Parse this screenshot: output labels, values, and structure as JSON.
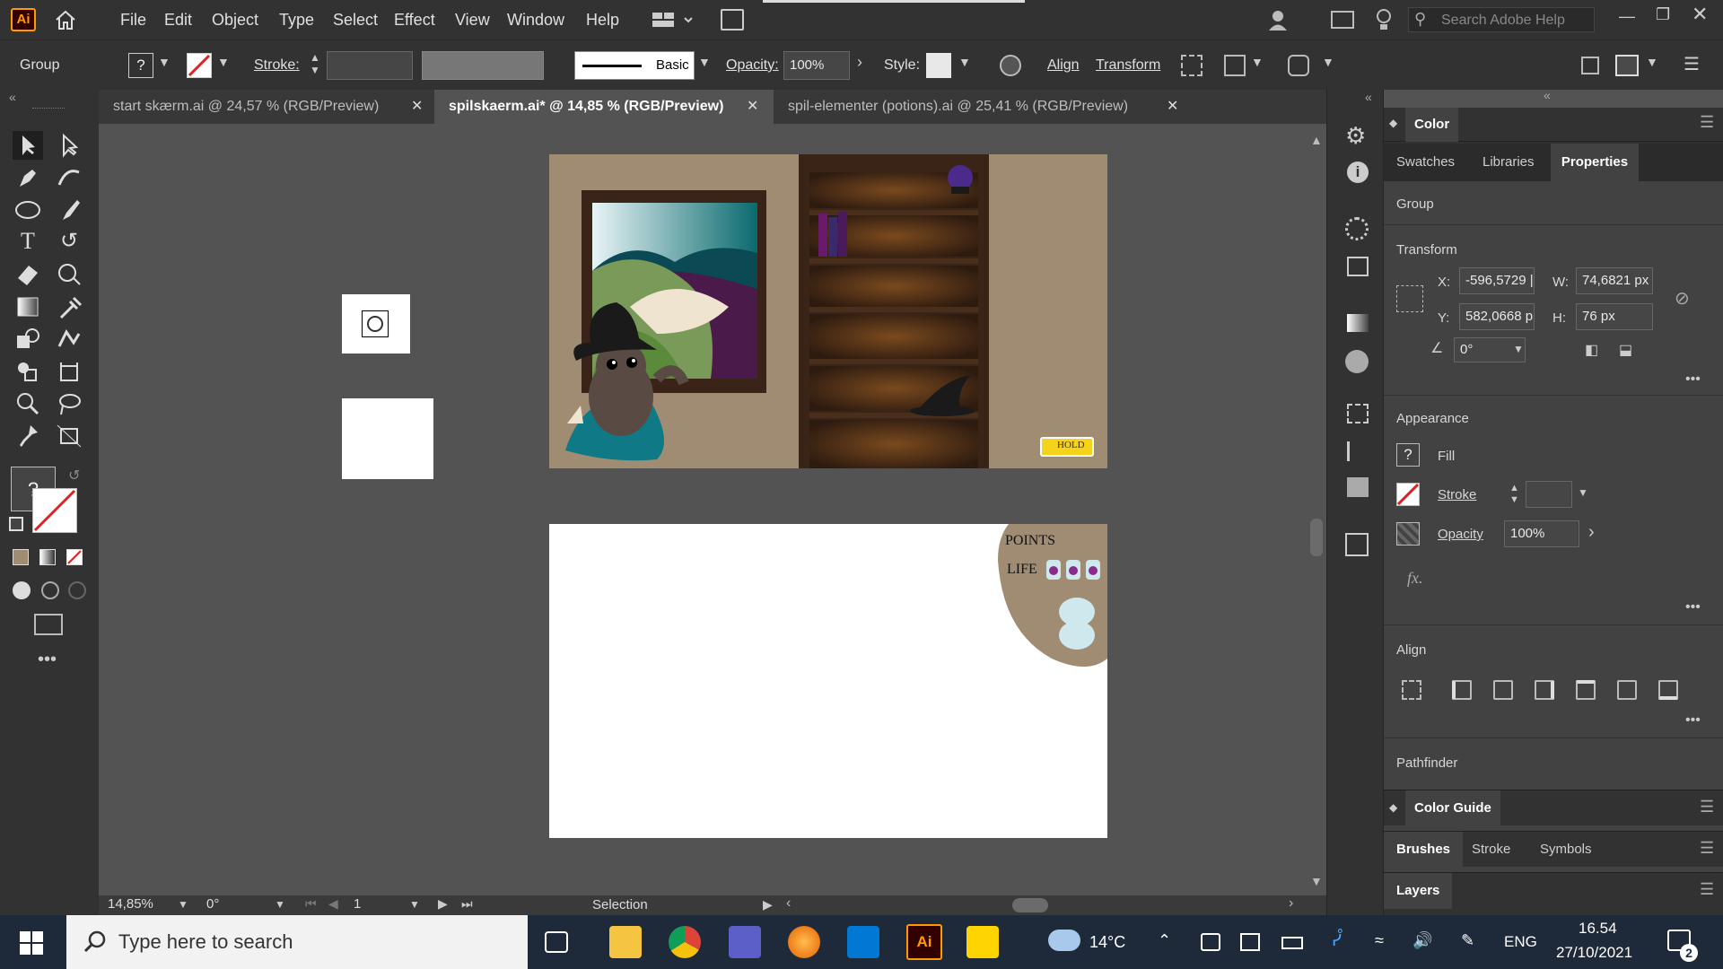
{
  "app": {
    "logo": "Ai",
    "colors": {
      "accent": "#ff9a00",
      "bg": "#535353",
      "panel": "#323232"
    }
  },
  "menubar": {
    "items": [
      "File",
      "Edit",
      "Object",
      "Type",
      "Select",
      "Effect",
      "View",
      "Window",
      "Help"
    ],
    "search_placeholder": "Search Adobe Help"
  },
  "control_bar": {
    "selection_type": "Group",
    "fill_unknown": "?",
    "stroke_label": "Stroke:",
    "brush_label": "Basic",
    "opacity_label": "Opacity:",
    "opacity_value": "100%",
    "style_label": "Style:",
    "align_label": "Align",
    "transform_label": "Transform"
  },
  "tabs": [
    {
      "label": "start skærm.ai @ 24,57 % (RGB/Preview)",
      "active": false
    },
    {
      "label": "spilskaerm.ai* @ 14,85 % (RGB/Preview)",
      "active": true
    },
    {
      "label": "spil-elementer (potions).ai @ 25,41 % (RGB/Preview)",
      "active": false
    }
  ],
  "canvas": {
    "artboard1": {
      "hold_label": "HOLD"
    },
    "artboard2": {
      "points_label": "POINTS",
      "life_label": "LIFE"
    }
  },
  "status": {
    "zoom": "14,85%",
    "rotation": "0°",
    "page": "1",
    "tool": "Selection"
  },
  "panel": {
    "header": "Color",
    "tabs": [
      "Swatches",
      "Libraries",
      "Properties"
    ],
    "active_tab": "Properties",
    "group_label": "Group",
    "transform": {
      "title": "Transform",
      "x_label": "X:",
      "x_value": "-596,5729 |",
      "y_label": "Y:",
      "y_value": "582,0668 p",
      "w_label": "W:",
      "w_value": "74,6821 px",
      "h_label": "H:",
      "h_value": "76 px",
      "angle_value": "0°"
    },
    "appearance": {
      "title": "Appearance",
      "fill_label": "Fill",
      "stroke_label": "Stroke",
      "opacity_label": "Opacity",
      "opacity_value": "100%",
      "fx_label": "fx."
    },
    "align_title": "Align",
    "pathfinder_title": "Pathfinder",
    "color_guide": "Color Guide",
    "bottom_tabs": [
      "Brushes",
      "Stroke",
      "Symbols"
    ],
    "layers": "Layers"
  },
  "taskbar": {
    "search_placeholder": "Type here to search",
    "weather": "14°C",
    "language": "ENG",
    "time": "16.54",
    "date": "27/10/2021",
    "notifications": "2"
  }
}
